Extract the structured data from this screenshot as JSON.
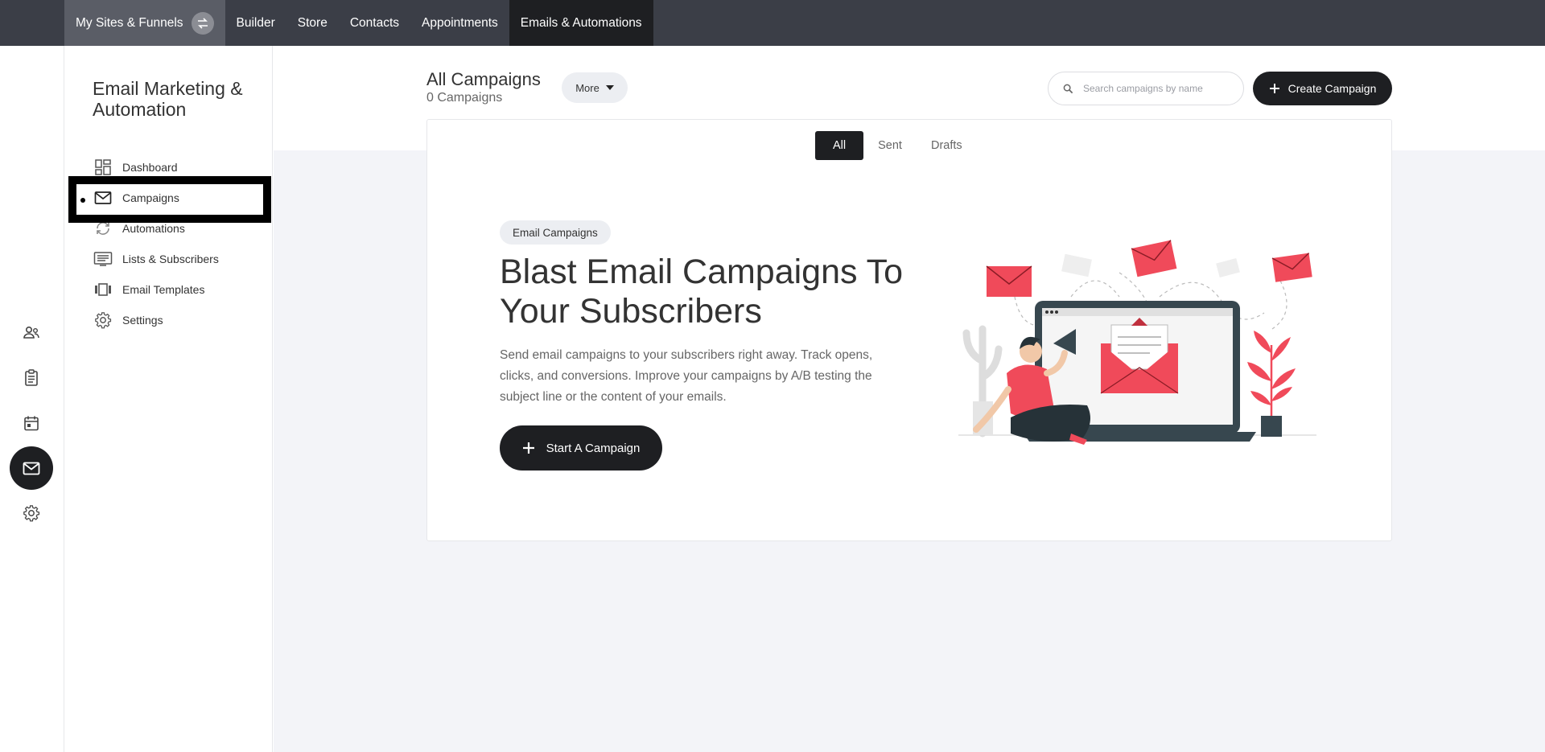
{
  "topnav": {
    "items": [
      {
        "label": "My Sites & Funnels"
      },
      {
        "label": "Builder"
      },
      {
        "label": "Store"
      },
      {
        "label": "Contacts"
      },
      {
        "label": "Appointments"
      },
      {
        "label": "Emails & Automations"
      }
    ]
  },
  "rail": {
    "icons": [
      "contacts-icon",
      "clipboard-icon",
      "calendar-icon",
      "mail-icon",
      "gear-icon"
    ],
    "active": "mail-icon"
  },
  "sidebar": {
    "title": "Email Marketing & Automation",
    "items": [
      {
        "label": "Dashboard",
        "icon": "dashboard-icon"
      },
      {
        "label": "Campaigns",
        "icon": "mail-icon"
      },
      {
        "label": "Automations",
        "icon": "refresh-icon"
      },
      {
        "label": "Lists & Subscribers",
        "icon": "list-icon"
      },
      {
        "label": "Email Templates",
        "icon": "templates-icon"
      },
      {
        "label": "Settings",
        "icon": "gear-icon"
      }
    ],
    "active": "Campaigns"
  },
  "header": {
    "title": "All Campaigns",
    "subtitle": "0 Campaigns",
    "more_label": "More",
    "search_placeholder": "Search campaigns by name",
    "create_label": "Create Campaign"
  },
  "tabs": [
    {
      "label": "All"
    },
    {
      "label": "Sent"
    },
    {
      "label": "Drafts"
    }
  ],
  "active_tab": "All",
  "empty_state": {
    "pill": "Email Campaigns",
    "headline": "Blast Email Campaigns To Your Subscribers",
    "description": "Send email campaigns to your subscribers right away. Track opens, clicks, and conversions. Improve your campaigns by A/B testing the subject line or the content of your emails.",
    "button_label": "Start A Campaign"
  },
  "colors": {
    "topbar": "#3b3e47",
    "dark": "#1e1f22",
    "accent_red": "#f04a5a",
    "page_bg": "#f3f4f8"
  }
}
